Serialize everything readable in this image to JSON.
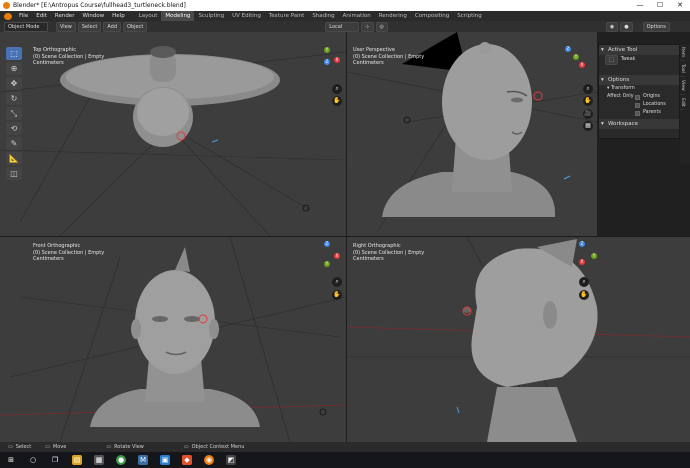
{
  "window": {
    "title": "Blender* [E:\\Antropus Course\\fullhead3_turtleneck.blend]",
    "controls": [
      "—",
      "☐",
      "✕"
    ]
  },
  "menu": {
    "items": [
      "File",
      "Edit",
      "Render",
      "Window",
      "Help"
    ]
  },
  "workspaces": {
    "tabs": [
      "Layout",
      "Modeling",
      "Sculpting",
      "UV Editing",
      "Texture Paint",
      "Shading",
      "Animation",
      "Rendering",
      "Compositing",
      "Scripting"
    ],
    "active": "Modeling"
  },
  "header": {
    "mode": "Object Mode",
    "menus": [
      "View",
      "Select",
      "Add",
      "Object"
    ],
    "orientation": "Local",
    "options": "Options"
  },
  "viewports": [
    {
      "name": "Top Orthographic",
      "collection": "(0) Scene Collection | Empty",
      "units": "Centimeters"
    },
    {
      "name": "User Perspective",
      "collection": "(0) Scene Collection | Empty",
      "units": "Centimeters"
    },
    {
      "name": "Front Orthographic",
      "collection": "(0) Scene Collection | Empty",
      "units": "Centimeters"
    },
    {
      "name": "Right Orthographic",
      "collection": "(0) Scene Collection | Empty",
      "units": "Centimeters"
    }
  ],
  "gizmo": {
    "x": "X",
    "y": "Y",
    "z": "Z",
    "x_color": "#e8383d",
    "y_color": "#6ea21b",
    "z_color": "#3f8aec"
  },
  "npanel": {
    "active_tool_header": "Active Tool",
    "tool_name": "Tweak",
    "options_header": "Options",
    "transform_header": "Transform",
    "affect_only_label": "Affect Only",
    "affect_items": [
      "Origins",
      "Locations",
      "Parents"
    ],
    "workspace_header": "Workspace",
    "tabs": [
      "Item",
      "Tool",
      "View",
      "Edit"
    ]
  },
  "statusbar": {
    "select": "Select",
    "move": "Move",
    "rotate": "Rotate View",
    "context": "Object Context Menu"
  },
  "accent": "#4772b3",
  "icons": [
    "windows-start-icon",
    "search-icon",
    "task-view-icon",
    "explorer-icon",
    "chrome-icon",
    "brave-icon",
    "blender-icon"
  ]
}
